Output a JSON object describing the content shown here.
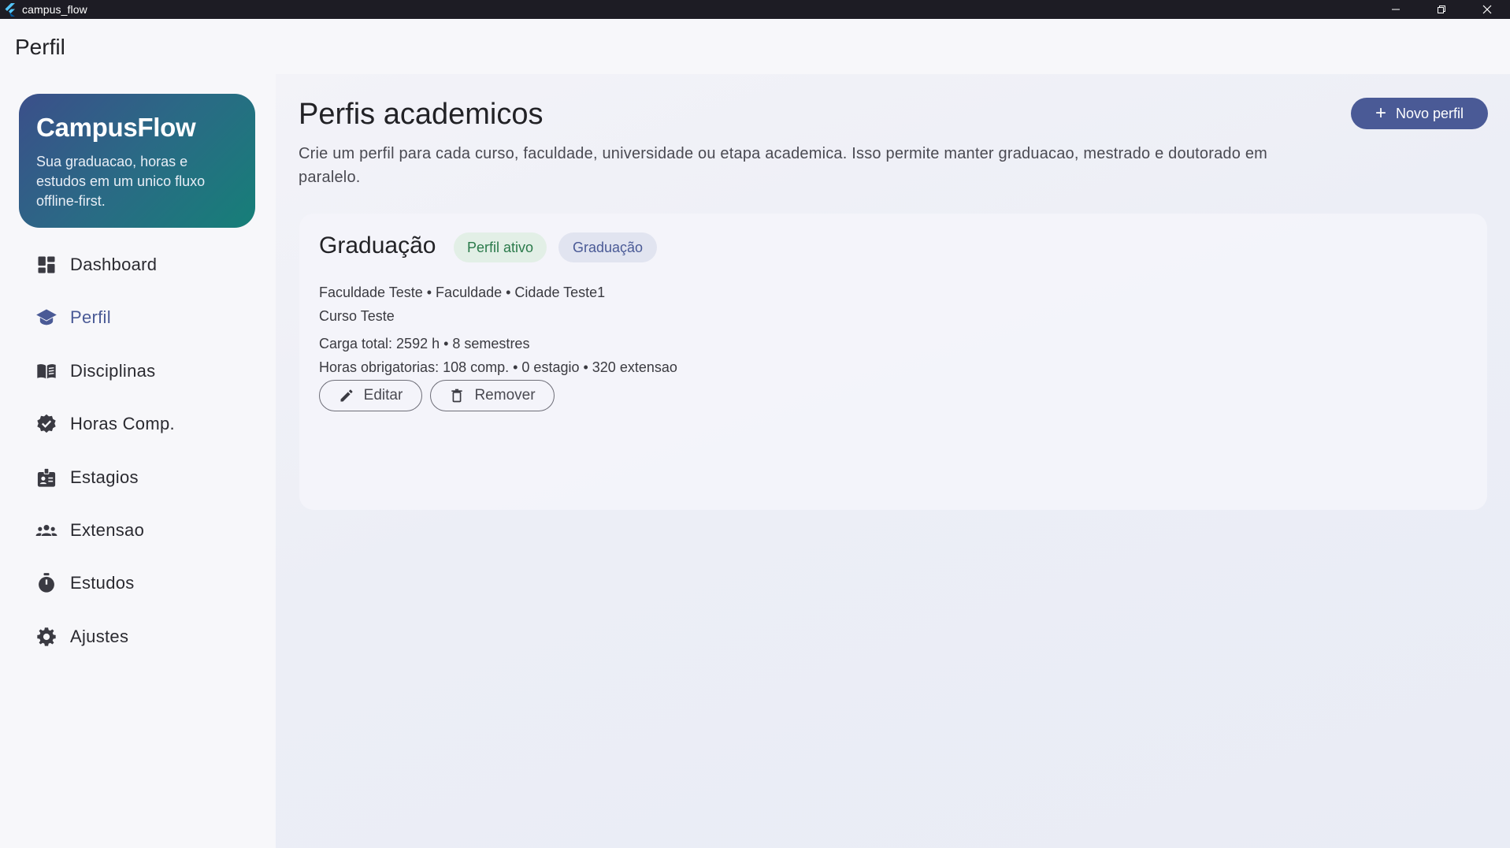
{
  "window": {
    "title": "campus_flow"
  },
  "appbar": {
    "title": "Perfil"
  },
  "brand": {
    "name": "CampusFlow",
    "tagline": "Sua graduacao, horas e estudos em um unico fluxo offline-first."
  },
  "sidebar": {
    "items": [
      {
        "label": "Dashboard",
        "icon": "dashboard-icon",
        "active": false
      },
      {
        "label": "Perfil",
        "icon": "graduation-cap-icon",
        "active": true
      },
      {
        "label": "Disciplinas",
        "icon": "book-icon",
        "active": false
      },
      {
        "label": "Horas Comp.",
        "icon": "verified-badge-icon",
        "active": false
      },
      {
        "label": "Estagios",
        "icon": "badge-id-icon",
        "active": false
      },
      {
        "label": "Extensao",
        "icon": "group-icon",
        "active": false
      },
      {
        "label": "Estudos",
        "icon": "timer-icon",
        "active": false
      },
      {
        "label": "Ajustes",
        "icon": "gear-icon",
        "active": false
      }
    ]
  },
  "main": {
    "title": "Perfis academicos",
    "description": "Crie um perfil para cada curso, faculdade, universidade ou etapa academica. Isso permite manter graduacao, mestrado e doutorado em paralelo.",
    "new_profile_label": "Novo perfil"
  },
  "profile": {
    "title": "Graduação",
    "active_badge": "Perfil ativo",
    "type_badge": "Graduação",
    "institution_line": "Faculdade Teste • Faculdade • Cidade Teste1",
    "course_line": "Curso Teste",
    "workload_line": "Carga total: 2592 h • 8 semestres",
    "hours_line": "Horas obrigatorias: 108 comp. • 0 estagio • 320 extensao",
    "edit_label": "Editar",
    "remove_label": "Remover"
  },
  "colors": {
    "accent": "#4a5a96",
    "titlebar": "#1d1c24",
    "active_badge_bg": "#e2efe6",
    "active_badge_text": "#2a7a4a"
  }
}
